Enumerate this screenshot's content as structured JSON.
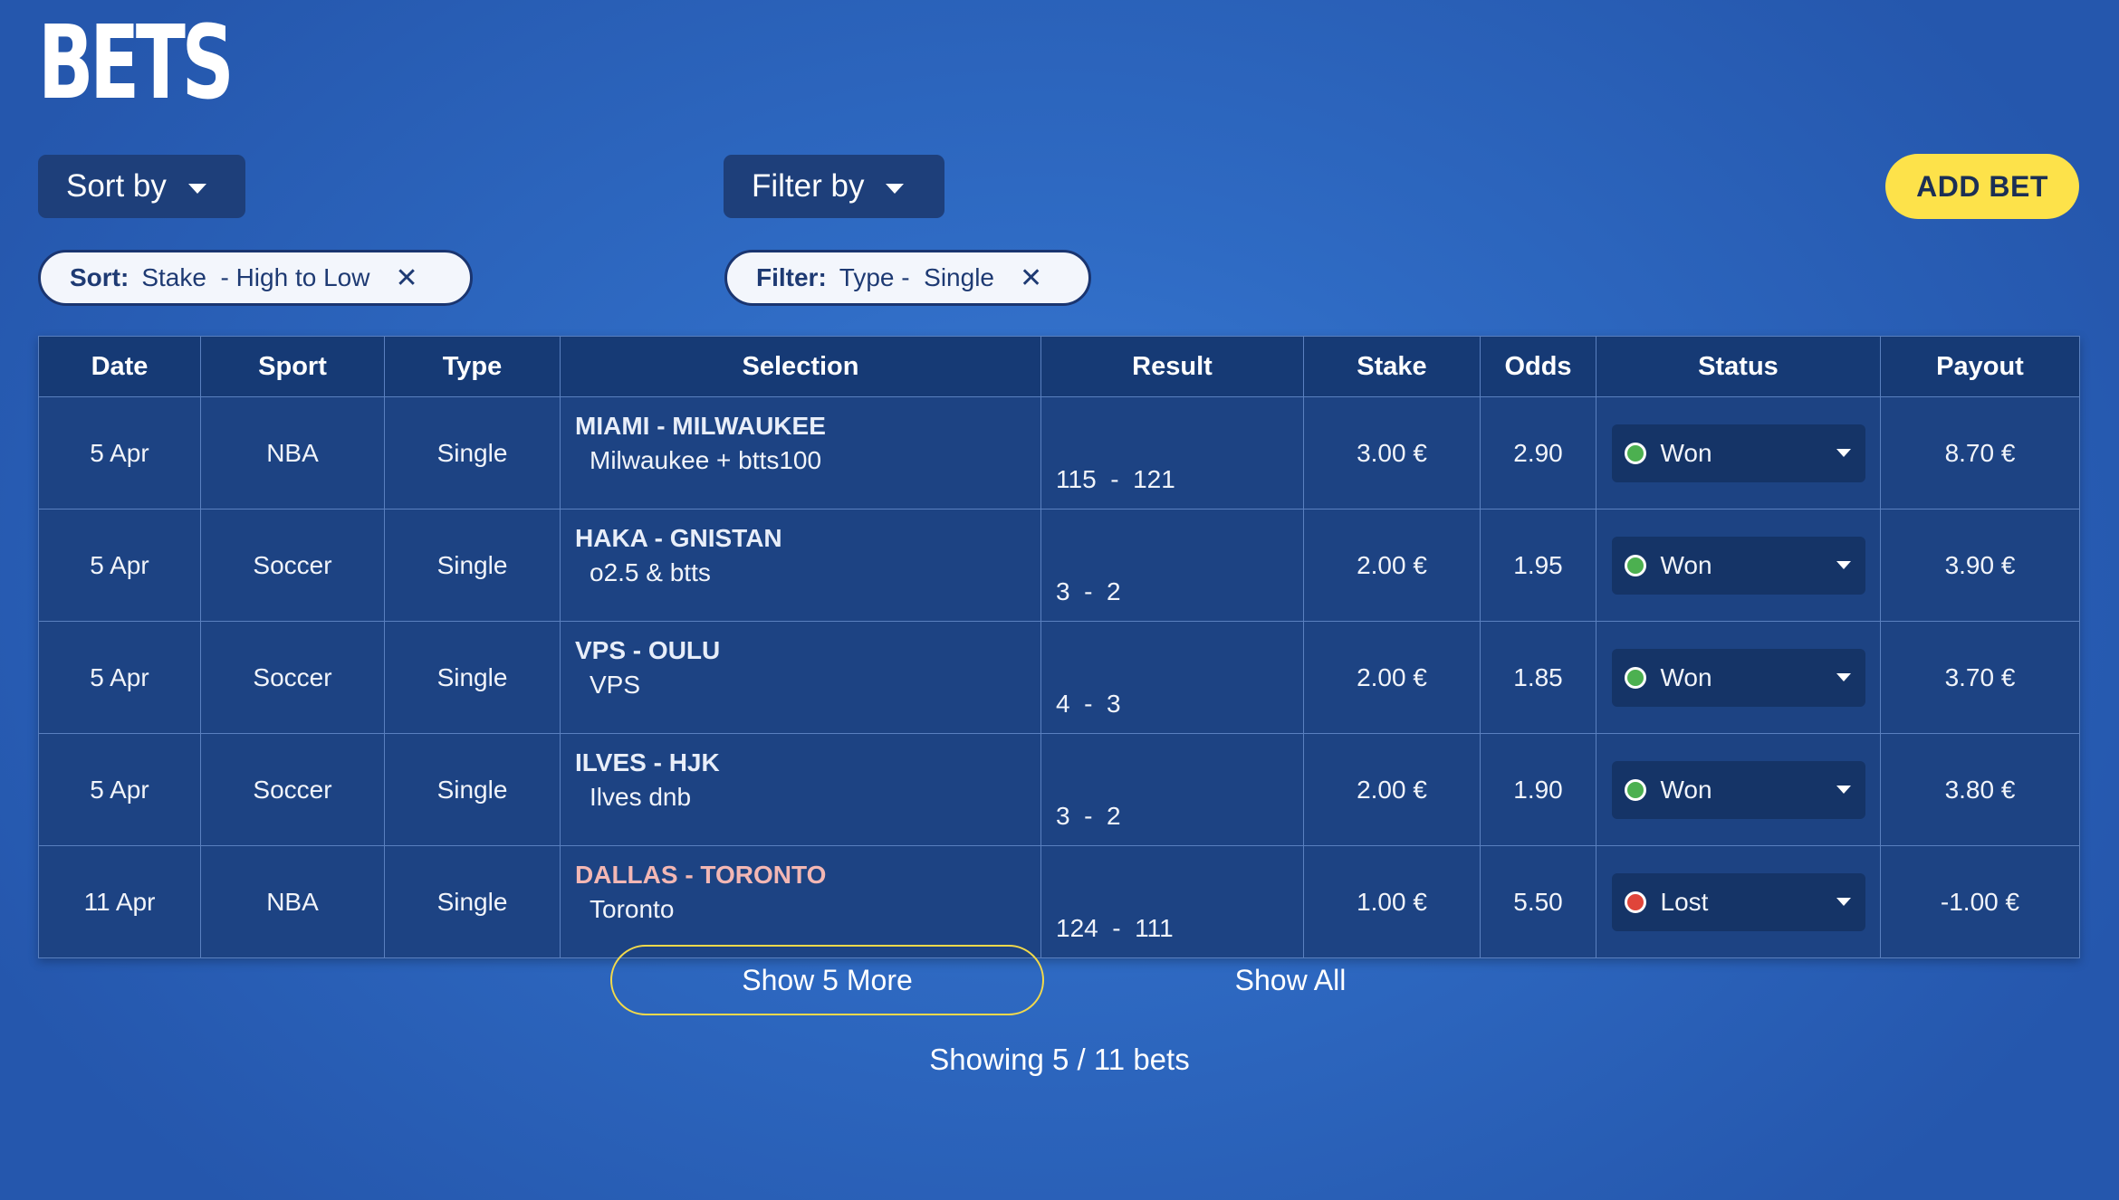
{
  "header": {
    "title": "BETS"
  },
  "controls": {
    "sort_label": "Sort by",
    "filter_label": "Filter by",
    "add_bet_label": "ADD BET"
  },
  "chips": {
    "sort": {
      "key": "Sort:",
      "value": "Stake  - High to Low",
      "close": "✕"
    },
    "filter": {
      "key": "Filter:",
      "value": "Type -  Single",
      "close": "✕"
    }
  },
  "table": {
    "columns": [
      "Date",
      "Sport",
      "Type",
      "Selection",
      "Result",
      "Stake",
      "Odds",
      "Status",
      "Payout"
    ],
    "rows": [
      {
        "date": "5 Apr",
        "sport": "NBA",
        "type": "Single",
        "match": "MIAMI - MILWAUKEE",
        "pick": "Milwaukee + btts100",
        "result": "115  -  121",
        "stake": "3.00 €",
        "odds": "2.90",
        "status": "Won",
        "payout": "8.70 €"
      },
      {
        "date": "5 Apr",
        "sport": "Soccer",
        "type": "Single",
        "match": "HAKA - GNISTAN",
        "pick": "o2.5 & btts",
        "result": "3  -  2",
        "stake": "2.00 €",
        "odds": "1.95",
        "status": "Won",
        "payout": "3.90 €"
      },
      {
        "date": "5 Apr",
        "sport": "Soccer",
        "type": "Single",
        "match": "VPS - OULU",
        "pick": "VPS",
        "result": "4  -  3",
        "stake": "2.00 €",
        "odds": "1.85",
        "status": "Won",
        "payout": "3.70 €"
      },
      {
        "date": "5 Apr",
        "sport": "Soccer",
        "type": "Single",
        "match": "ILVES - HJK",
        "pick": "Ilves dnb",
        "result": "3  -  2",
        "stake": "2.00 €",
        "odds": "1.90",
        "status": "Won",
        "payout": "3.80 €"
      },
      {
        "date": "11 Apr",
        "sport": "NBA",
        "type": "Single",
        "match": "DALLAS - TORONTO",
        "pick": "Toronto",
        "result": "124  -  111",
        "stake": "1.00 €",
        "odds": "5.50",
        "status": "Lost",
        "payout": "-1.00 €"
      }
    ]
  },
  "status_colors": {
    "Won": "#4cb050",
    "Lost": "#e0453a"
  },
  "footer": {
    "show_more_label": "Show 5 More",
    "show_all_label": "Show All",
    "showing_text": "Showing 5 / 11 bets"
  },
  "theme": {
    "accent": "#fde24a",
    "background": "#2f6bc4",
    "table_background": "#1d4383"
  }
}
